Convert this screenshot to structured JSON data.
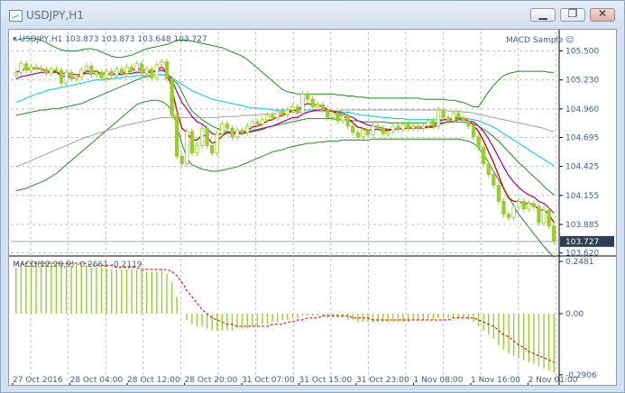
{
  "window": {
    "title": "USDJPY,H1",
    "buttons": [
      {
        "name": "minimize-button",
        "glyph": "▁"
      },
      {
        "name": "restore-button",
        "glyph": "❐"
      },
      {
        "name": "close-button",
        "glyph": "✕"
      }
    ]
  },
  "chart_data": [
    {
      "type": "candlestick",
      "header": "▾ USDJPY,H1  103.873 103.873 103.648 103.727",
      "indicator_label": "MACD Sample",
      "smiley": "☺",
      "ylim": [
        103.6,
        105.68
      ],
      "y_ticks": [
        "105.500",
        "105.230",
        "104.960",
        "104.695",
        "104.425",
        "104.155",
        "103.885",
        "103.620"
      ],
      "y_tick_values": [
        105.5,
        105.23,
        104.96,
        104.695,
        104.425,
        104.155,
        103.885,
        103.62
      ],
      "current_price": "103.727",
      "current_price_value": 103.727,
      "x_labels": [
        "27 Oct 2016",
        "28 Oct 04:00",
        "28 Oct 12:00",
        "28 Oct 20:00",
        "31 Oct 07:00",
        "31 Oct 15:00",
        "31 Oct 23:00",
        "1 Nov 08:00",
        "1 Nov 16:00",
        "2 Nov 01:00"
      ],
      "colors": {
        "bull_candle": "#9acd32",
        "bear_candle": "#9acd32",
        "ma_fast": "#cc0000",
        "ma_mid": "#990099",
        "ma_slow": "#00c8e6",
        "ma_long": "#a0a0a0",
        "bands": "#228b22",
        "grid": "#c0c0c0",
        "text": "#3a5f8f"
      },
      "closes": [
        105.3,
        105.38,
        105.32,
        105.35,
        105.34,
        105.33,
        105.29,
        105.33,
        105.32,
        105.2,
        105.3,
        105.24,
        105.26,
        105.32,
        105.36,
        105.28,
        105.3,
        105.25,
        105.31,
        105.27,
        105.33,
        105.29,
        105.35,
        105.31,
        105.38,
        105.29,
        105.33,
        105.25,
        105.37,
        105.4,
        105.24,
        104.9,
        104.52,
        104.45,
        104.75,
        104.55,
        104.62,
        104.78,
        104.62,
        104.55,
        104.73,
        104.82,
        104.78,
        104.7,
        104.76,
        104.74,
        104.8,
        104.84,
        104.82,
        104.86,
        104.9,
        104.88,
        104.94,
        104.91,
        104.95,
        104.98,
        104.92,
        105.1,
        105.05,
        104.98,
        105.0,
        104.95,
        104.88,
        104.92,
        104.85,
        104.9,
        104.8,
        104.74,
        104.7,
        104.76,
        104.72,
        104.8,
        104.78,
        104.73,
        104.75,
        104.8,
        104.77,
        104.82,
        104.78,
        104.8,
        104.78,
        104.8,
        104.85,
        104.8,
        104.95,
        104.88,
        104.85,
        104.92,
        104.88,
        104.85,
        104.8,
        104.7,
        104.6,
        104.45,
        104.35,
        104.25,
        104.1,
        103.98,
        103.95,
        104.05,
        104.1,
        104.03,
        104.08,
        104.05,
        103.9,
        104.02,
        103.87,
        103.73
      ],
      "ma_fast": [
        105.3,
        105.32,
        105.33,
        105.33,
        105.34,
        105.33,
        105.31,
        105.31,
        105.31,
        105.26,
        105.27,
        105.25,
        105.25,
        105.28,
        105.31,
        105.31,
        105.31,
        105.29,
        105.29,
        105.28,
        105.29,
        105.29,
        105.31,
        105.31,
        105.34,
        105.32,
        105.32,
        105.3,
        105.32,
        105.35,
        105.3,
        105.15,
        104.94,
        104.78,
        104.74,
        104.67,
        104.67,
        104.72,
        104.7,
        104.64,
        104.66,
        104.71,
        104.74,
        104.74,
        104.75,
        104.74,
        104.76,
        104.79,
        104.8,
        104.82,
        104.85,
        104.86,
        104.89,
        104.9,
        104.92,
        104.95,
        104.94,
        104.99,
        105.01,
        105.0,
        105.0,
        104.98,
        104.95,
        104.94,
        104.91,
        104.9,
        104.87,
        104.83,
        104.79,
        104.78,
        104.76,
        104.77,
        104.77,
        104.76,
        104.76,
        104.77,
        104.77,
        104.78,
        104.78,
        104.79,
        104.79,
        104.79,
        104.8,
        104.8,
        104.84,
        104.86,
        104.86,
        104.87,
        104.88,
        104.87,
        104.85,
        104.81,
        104.75,
        104.66,
        104.56,
        104.46,
        104.34,
        104.22,
        104.13,
        104.1,
        104.1,
        104.08,
        104.08,
        104.07,
        104.02,
        104.02,
        103.98,
        103.9
      ],
      "ma_mid": [
        105.24,
        105.26,
        105.27,
        105.28,
        105.29,
        105.3,
        105.3,
        105.3,
        105.3,
        105.29,
        105.29,
        105.28,
        105.28,
        105.28,
        105.29,
        105.29,
        105.29,
        105.29,
        105.29,
        105.28,
        105.28,
        105.28,
        105.29,
        105.29,
        105.3,
        105.3,
        105.3,
        105.3,
        105.31,
        105.32,
        105.3,
        105.23,
        105.12,
        105.02,
        104.96,
        104.89,
        104.84,
        104.82,
        104.78,
        104.73,
        104.72,
        104.73,
        104.74,
        104.73,
        104.73,
        104.73,
        104.74,
        104.75,
        104.76,
        104.77,
        104.79,
        104.8,
        104.82,
        104.84,
        104.86,
        104.88,
        104.88,
        104.91,
        104.93,
        104.94,
        104.95,
        104.95,
        104.94,
        104.94,
        104.93,
        104.92,
        104.9,
        104.88,
        104.85,
        104.83,
        104.81,
        104.8,
        104.79,
        104.78,
        104.77,
        104.77,
        104.77,
        104.78,
        104.78,
        104.78,
        104.78,
        104.78,
        104.79,
        104.79,
        104.81,
        104.83,
        104.84,
        104.85,
        104.86,
        104.86,
        104.85,
        104.84,
        104.8,
        104.75,
        104.68,
        104.6,
        104.51,
        104.42,
        104.34,
        104.28,
        104.23,
        104.19,
        104.16,
        104.14,
        104.1,
        104.08,
        104.04,
        103.99
      ],
      "ma_slow": [
        105.02,
        105.04,
        105.06,
        105.08,
        105.1,
        105.11,
        105.13,
        105.14,
        105.15,
        105.16,
        105.17,
        105.18,
        105.19,
        105.2,
        105.21,
        105.22,
        105.23,
        105.23,
        105.24,
        105.24,
        105.25,
        105.25,
        105.26,
        105.26,
        105.27,
        105.27,
        105.27,
        105.27,
        105.28,
        105.28,
        105.27,
        105.25,
        105.22,
        105.19,
        105.16,
        105.13,
        105.11,
        105.09,
        105.07,
        105.05,
        105.04,
        105.03,
        105.02,
        105.01,
        105.0,
        104.99,
        104.98,
        104.97,
        104.97,
        104.96,
        104.96,
        104.95,
        104.95,
        104.95,
        104.95,
        104.95,
        104.95,
        104.95,
        104.95,
        104.95,
        104.95,
        104.95,
        104.94,
        104.94,
        104.94,
        104.93,
        104.93,
        104.92,
        104.91,
        104.9,
        104.9,
        104.89,
        104.89,
        104.88,
        104.88,
        104.87,
        104.87,
        104.87,
        104.86,
        104.86,
        104.86,
        104.86,
        104.86,
        104.86,
        104.86,
        104.86,
        104.87,
        104.87,
        104.87,
        104.87,
        104.87,
        104.86,
        104.85,
        104.83,
        104.81,
        104.79,
        104.76,
        104.73,
        104.7,
        104.67,
        104.64,
        104.61,
        104.58,
        104.55,
        104.52,
        104.49,
        104.46,
        104.43
      ],
      "ma_long": [
        104.42,
        104.44,
        104.46,
        104.48,
        104.5,
        104.52,
        104.54,
        104.56,
        104.58,
        104.6,
        104.62,
        104.64,
        104.66,
        104.68,
        104.7,
        104.71,
        104.73,
        104.74,
        104.76,
        104.77,
        104.78,
        104.8,
        104.81,
        104.82,
        104.83,
        104.84,
        104.85,
        104.86,
        104.87,
        104.88,
        104.88,
        104.88,
        104.88,
        104.88,
        104.88,
        104.88,
        104.88,
        104.88,
        104.88,
        104.88,
        104.88,
        104.89,
        104.89,
        104.89,
        104.89,
        104.9,
        104.9,
        104.9,
        104.9,
        104.91,
        104.91,
        104.91,
        104.92,
        104.92,
        104.92,
        104.93,
        104.93,
        104.93,
        104.93,
        104.94,
        104.94,
        104.94,
        104.94,
        104.94,
        104.94,
        104.95,
        104.95,
        104.95,
        104.95,
        104.95,
        104.95,
        104.95,
        104.95,
        104.95,
        104.95,
        104.95,
        104.95,
        104.95,
        104.95,
        104.95,
        104.95,
        104.95,
        104.95,
        104.95,
        104.95,
        104.95,
        104.94,
        104.94,
        104.94,
        104.93,
        104.93,
        104.92,
        104.91,
        104.9,
        104.89,
        104.88,
        104.87,
        104.86,
        104.85,
        104.84,
        104.83,
        104.82,
        104.81,
        104.8,
        104.79,
        104.78,
        104.76,
        104.75
      ],
      "band_upper": [
        105.6,
        105.61,
        105.62,
        105.62,
        105.61,
        105.6,
        105.58,
        105.55,
        105.53,
        105.51,
        105.5,
        105.5,
        105.5,
        105.51,
        105.52,
        105.52,
        105.51,
        105.49,
        105.47,
        105.45,
        105.44,
        105.44,
        105.45,
        105.46,
        105.48,
        105.5,
        105.52,
        105.53,
        105.54,
        105.55,
        105.56,
        105.58,
        105.6,
        105.6,
        105.6,
        105.59,
        105.58,
        105.57,
        105.56,
        105.55,
        105.54,
        105.53,
        105.51,
        105.49,
        105.47,
        105.45,
        105.42,
        105.38,
        105.34,
        105.3,
        105.26,
        105.22,
        105.18,
        105.14,
        105.12,
        105.11,
        105.1,
        105.1,
        105.1,
        105.1,
        105.1,
        105.1,
        105.1,
        105.1,
        105.09,
        105.09,
        105.08,
        105.08,
        105.07,
        105.07,
        105.06,
        105.06,
        105.06,
        105.06,
        105.06,
        105.06,
        105.06,
        105.06,
        105.06,
        105.06,
        105.06,
        105.05,
        105.05,
        105.05,
        105.05,
        105.05,
        105.04,
        105.04,
        105.03,
        105.02,
        105.0,
        104.98,
        104.98,
        105.05,
        105.12,
        105.18,
        105.23,
        105.27,
        105.29,
        105.3,
        105.31,
        105.31,
        105.31,
        105.31,
        105.31,
        105.31,
        105.3,
        105.3
      ],
      "band_lower": [
        104.2,
        104.21,
        104.22,
        104.24,
        104.26,
        104.28,
        104.3,
        104.33,
        104.36,
        104.4,
        104.44,
        104.48,
        104.52,
        104.56,
        104.6,
        104.64,
        104.68,
        104.72,
        104.76,
        104.8,
        104.84,
        104.88,
        104.92,
        104.96,
        105.0,
        105.02,
        105.03,
        105.04,
        105.04,
        105.03,
        105.0,
        104.95,
        104.8,
        104.64,
        104.5,
        104.44,
        104.42,
        104.4,
        104.39,
        104.38,
        104.38,
        104.39,
        104.4,
        104.41,
        104.42,
        104.44,
        104.46,
        104.48,
        104.5,
        104.52,
        104.54,
        104.56,
        104.57,
        104.58,
        104.6,
        104.61,
        104.62,
        104.63,
        104.64,
        104.64,
        104.65,
        104.65,
        104.66,
        104.66,
        104.66,
        104.67,
        104.67,
        104.67,
        104.67,
        104.67,
        104.67,
        104.68,
        104.68,
        104.68,
        104.68,
        104.68,
        104.68,
        104.68,
        104.68,
        104.68,
        104.68,
        104.68,
        104.68,
        104.68,
        104.68,
        104.68,
        104.68,
        104.68,
        104.68,
        104.67,
        104.66,
        104.64,
        104.6,
        104.54,
        104.46,
        104.38,
        104.3,
        104.22,
        104.14,
        104.06,
        103.98,
        103.92,
        103.86,
        103.8,
        103.74,
        103.68,
        103.63,
        103.58
      ],
      "band_mid": [
        104.9,
        104.91,
        104.92,
        104.93,
        104.94,
        104.95,
        104.95,
        104.96,
        104.96,
        104.97,
        104.98,
        104.99,
        105.0,
        105.01,
        105.03,
        105.05,
        105.07,
        105.09,
        105.11,
        105.13,
        105.15,
        105.17,
        105.19,
        105.21,
        105.23,
        105.25,
        105.26,
        105.27,
        105.28,
        105.28,
        105.27,
        105.24,
        105.2,
        105.12,
        105.02,
        104.94,
        104.9,
        104.86,
        104.83,
        104.8,
        104.78,
        104.76,
        104.75,
        104.74,
        104.74,
        104.74,
        104.75,
        104.76,
        104.77,
        104.78,
        104.79,
        104.8,
        104.81,
        104.82,
        104.83,
        104.84,
        104.85,
        104.86,
        104.87,
        104.87,
        104.87,
        104.87,
        104.87,
        104.87,
        104.86,
        104.86,
        104.86,
        104.85,
        104.85,
        104.84,
        104.84,
        104.84,
        104.84,
        104.84,
        104.83,
        104.83,
        104.83,
        104.83,
        104.83,
        104.83,
        104.83,
        104.83,
        104.83,
        104.83,
        104.83,
        104.83,
        104.84,
        104.84,
        104.84,
        104.84,
        104.83,
        104.82,
        104.8,
        104.77,
        104.74,
        104.7,
        104.66,
        104.61,
        104.56,
        104.51,
        104.46,
        104.42,
        104.37,
        104.33,
        104.29,
        104.24,
        104.2,
        104.16
      ]
    },
    {
      "type": "bar",
      "header": "MACD(12,26,9) -0.2661 -0.2119",
      "ylim": [
        -0.33,
        0.27
      ],
      "y_ticks": [
        "0.2481",
        "0.00",
        "-0.2906"
      ],
      "y_tick_values": [
        0.2481,
        0.0,
        -0.2906
      ],
      "macd": [
        0.22,
        0.23,
        0.24,
        0.24,
        0.25,
        0.25,
        0.25,
        0.25,
        0.24,
        0.24,
        0.24,
        0.23,
        0.23,
        0.23,
        0.23,
        0.22,
        0.22,
        0.22,
        0.22,
        0.21,
        0.21,
        0.21,
        0.21,
        0.21,
        0.21,
        0.21,
        0.2,
        0.2,
        0.2,
        0.21,
        0.19,
        0.15,
        0.08,
        0.0,
        -0.03,
        -0.05,
        -0.06,
        -0.06,
        -0.07,
        -0.08,
        -0.08,
        -0.08,
        -0.08,
        -0.08,
        -0.07,
        -0.07,
        -0.07,
        -0.06,
        -0.06,
        -0.05,
        -0.05,
        -0.04,
        -0.04,
        -0.03,
        -0.03,
        -0.02,
        -0.02,
        -0.01,
        -0.01,
        -0.01,
        -0.01,
        -0.01,
        -0.02,
        -0.02,
        -0.02,
        -0.02,
        -0.03,
        -0.03,
        -0.04,
        -0.04,
        -0.04,
        -0.04,
        -0.04,
        -0.04,
        -0.04,
        -0.04,
        -0.04,
        -0.04,
        -0.04,
        -0.03,
        -0.03,
        -0.03,
        -0.03,
        -0.03,
        -0.02,
        -0.02,
        -0.02,
        -0.02,
        -0.02,
        -0.02,
        -0.03,
        -0.04,
        -0.06,
        -0.08,
        -0.1,
        -0.12,
        -0.15,
        -0.17,
        -0.19,
        -0.2,
        -0.21,
        -0.22,
        -0.23,
        -0.24,
        -0.25,
        -0.26,
        -0.27,
        -0.28
      ],
      "signal": [
        0.24,
        0.24,
        0.24,
        0.24,
        0.24,
        0.24,
        0.24,
        0.24,
        0.24,
        0.24,
        0.24,
        0.24,
        0.24,
        0.24,
        0.24,
        0.23,
        0.23,
        0.23,
        0.23,
        0.23,
        0.22,
        0.22,
        0.22,
        0.22,
        0.22,
        0.21,
        0.21,
        0.21,
        0.21,
        0.21,
        0.21,
        0.2,
        0.18,
        0.15,
        0.11,
        0.08,
        0.05,
        0.02,
        0.0,
        -0.02,
        -0.03,
        -0.04,
        -0.05,
        -0.05,
        -0.06,
        -0.06,
        -0.06,
        -0.06,
        -0.06,
        -0.06,
        -0.06,
        -0.05,
        -0.05,
        -0.05,
        -0.04,
        -0.04,
        -0.03,
        -0.03,
        -0.02,
        -0.02,
        -0.02,
        -0.01,
        -0.01,
        -0.01,
        -0.01,
        -0.01,
        -0.01,
        -0.02,
        -0.02,
        -0.02,
        -0.02,
        -0.03,
        -0.03,
        -0.03,
        -0.03,
        -0.03,
        -0.03,
        -0.03,
        -0.03,
        -0.03,
        -0.03,
        -0.03,
        -0.03,
        -0.03,
        -0.03,
        -0.03,
        -0.03,
        -0.02,
        -0.02,
        -0.02,
        -0.02,
        -0.02,
        -0.03,
        -0.04,
        -0.05,
        -0.06,
        -0.08,
        -0.1,
        -0.11,
        -0.13,
        -0.15,
        -0.16,
        -0.18,
        -0.19,
        -0.2,
        -0.21,
        -0.22,
        -0.23
      ]
    }
  ]
}
